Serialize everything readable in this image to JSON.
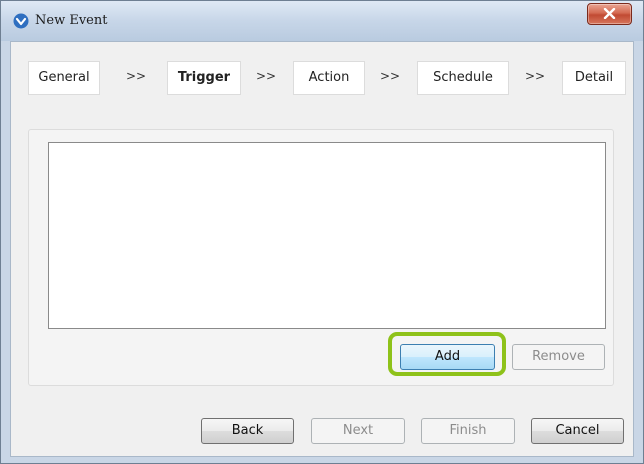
{
  "window": {
    "title": "New Event"
  },
  "wizard": {
    "steps": [
      {
        "label": "General",
        "active": false
      },
      {
        "label": "Trigger",
        "active": true
      },
      {
        "label": "Action",
        "active": false
      },
      {
        "label": "Schedule",
        "active": false
      },
      {
        "label": "Detail",
        "active": false
      }
    ],
    "separator": ">>"
  },
  "trigger_list": {
    "items": []
  },
  "list_buttons": {
    "add_label": "Add",
    "remove_label": "Remove"
  },
  "footer": {
    "back_label": "Back",
    "next_label": "Next",
    "finish_label": "Finish",
    "cancel_label": "Cancel"
  },
  "colors": {
    "highlight": "#8ec21a",
    "focused_button": "#bee6fd"
  },
  "icons": {
    "app": "app-logo-icon",
    "close": "close-icon"
  }
}
